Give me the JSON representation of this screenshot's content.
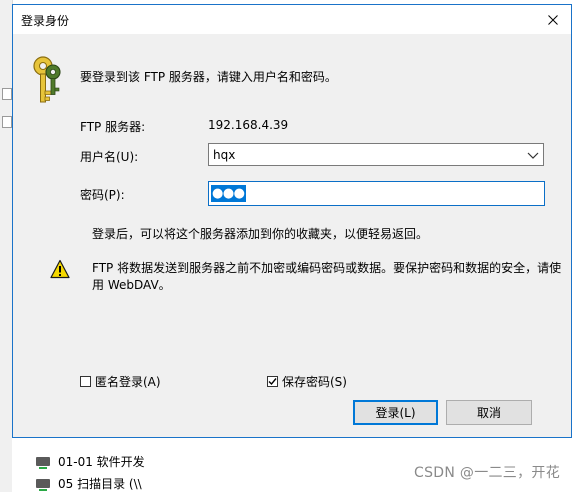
{
  "dialog": {
    "title": "登录身份",
    "intro": "要登录到该 FTP 服务器，请键入用户名和密码。",
    "server_label": "FTP 服务器:",
    "server_value": "192.168.4.39",
    "username_label": "用户名(U):",
    "username_value": "hqx",
    "password_label": "密码(P):",
    "password_mask": "●●●",
    "info_text": "登录后，可以将这个服务器添加到你的收藏夹，以便轻易返回。",
    "warning_text": "FTP 将数据发送到服务器之前不加密或编码密码或数据。要保护密码和数据的安全，请使用 WebDAV。",
    "anonymous_label": "匿名登录(A)",
    "anonymous_checked": false,
    "save_password_label": "保存密码(S)",
    "save_password_checked": true,
    "login_button": "登录(L)",
    "cancel_button": "取消"
  },
  "background": {
    "items": [
      "01-01 软件开发",
      "05 扫描目录 (\\\\"
    ]
  },
  "watermark": "CSDN @一二三，开花",
  "colors": {
    "accent": "#0078d7",
    "border": "#1a73c9",
    "dialog_bg": "#f0f0f0",
    "warning": "#f5d800"
  }
}
